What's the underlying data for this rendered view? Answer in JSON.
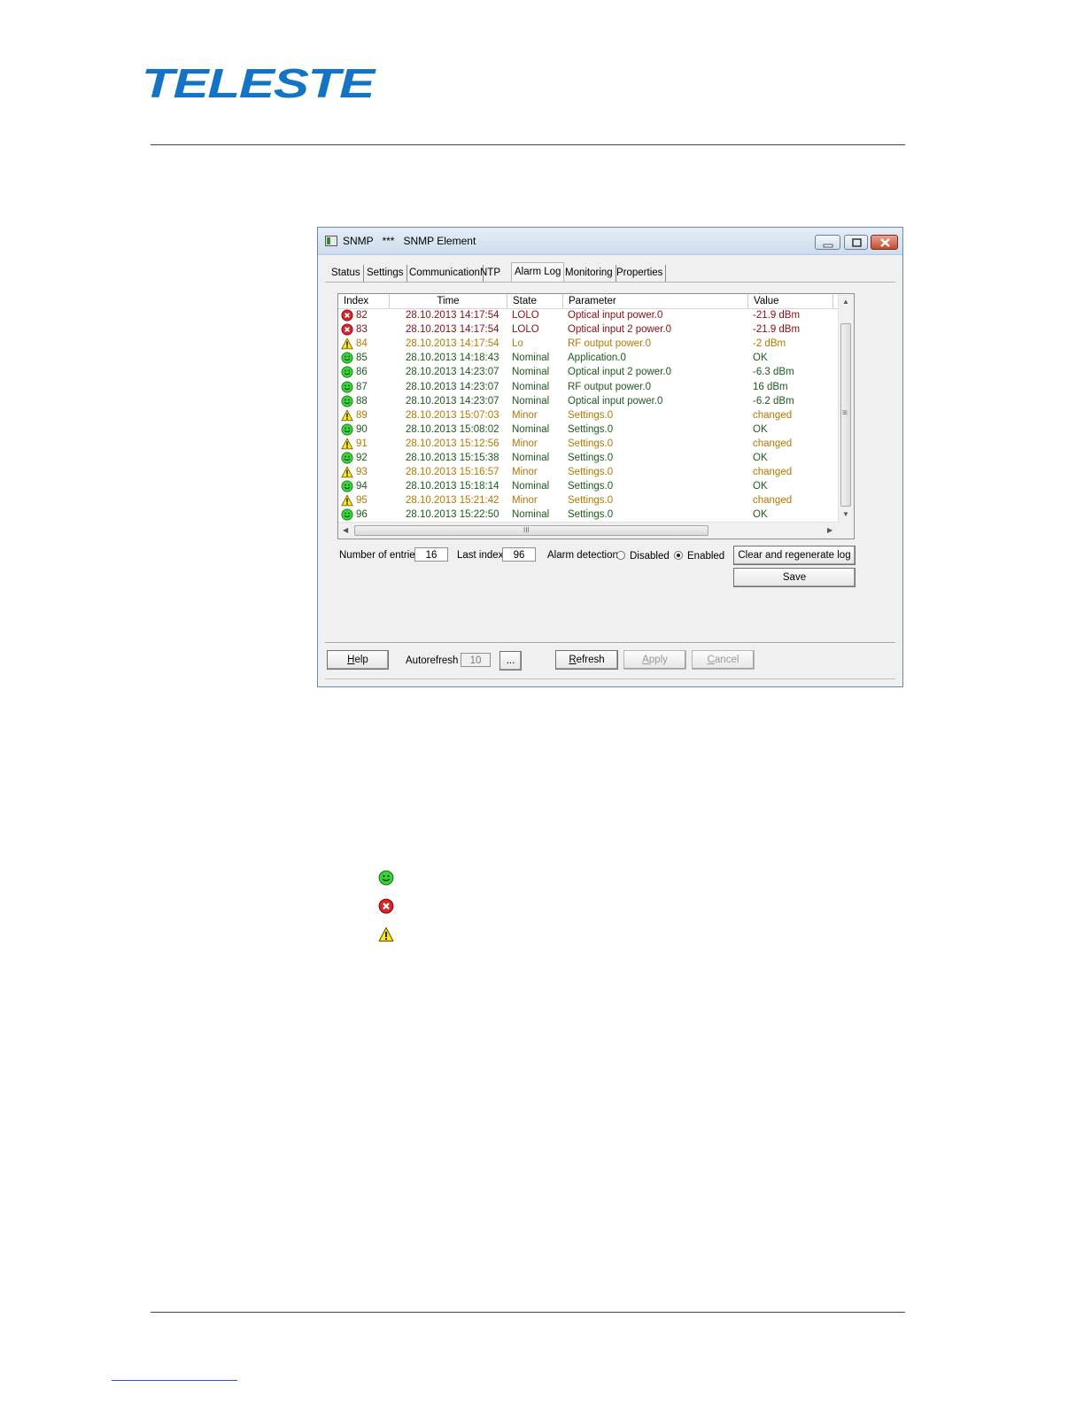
{
  "document": {
    "logo_text": "TELESTE"
  },
  "window": {
    "title": "SNMP   ***   SNMP Element",
    "tabs": [
      {
        "label": "Status"
      },
      {
        "label": "Settings"
      },
      {
        "label": "Communication"
      },
      {
        "label": "NTP"
      },
      {
        "label": "Alarm Log"
      },
      {
        "label": "Monitoring"
      },
      {
        "label": "Properties"
      }
    ],
    "active_tab": "Alarm Log"
  },
  "alarm_log": {
    "columns": {
      "index": "Index",
      "time": "Time",
      "state": "State",
      "parameter": "Parameter",
      "value": "Value"
    },
    "rows": [
      {
        "icon": "error",
        "index": "82",
        "time": "28.10.2013 14:17:54",
        "state": "LOLO",
        "parameter": "Optical input power.0",
        "value": "-21.9 dBm"
      },
      {
        "icon": "error",
        "index": "83",
        "time": "28.10.2013 14:17:54",
        "state": "LOLO",
        "parameter": "Optical input 2 power.0",
        "value": "-21.9 dBm"
      },
      {
        "icon": "warning",
        "index": "84",
        "time": "28.10.2013 14:17:54",
        "state": "Lo",
        "parameter": "RF output power.0",
        "value": "-2 dBm"
      },
      {
        "icon": "ok",
        "index": "85",
        "time": "28.10.2013 14:18:43",
        "state": "Nominal",
        "parameter": "Application.0",
        "value": "OK"
      },
      {
        "icon": "ok",
        "index": "86",
        "time": "28.10.2013 14:23:07",
        "state": "Nominal",
        "parameter": "Optical input 2 power.0",
        "value": "-6.3 dBm"
      },
      {
        "icon": "ok",
        "index": "87",
        "time": "28.10.2013 14:23:07",
        "state": "Nominal",
        "parameter": "RF output power.0",
        "value": "16 dBm"
      },
      {
        "icon": "ok",
        "index": "88",
        "time": "28.10.2013 14:23:07",
        "state": "Nominal",
        "parameter": "Optical input power.0",
        "value": "-6.2 dBm"
      },
      {
        "icon": "warning",
        "index": "89",
        "time": "28.10.2013 15:07:03",
        "state": "Minor",
        "parameter": "Settings.0",
        "value": "changed"
      },
      {
        "icon": "ok",
        "index": "90",
        "time": "28.10.2013 15:08:02",
        "state": "Nominal",
        "parameter": "Settings.0",
        "value": "OK"
      },
      {
        "icon": "warning",
        "index": "91",
        "time": "28.10.2013 15:12:56",
        "state": "Minor",
        "parameter": "Settings.0",
        "value": "changed"
      },
      {
        "icon": "ok",
        "index": "92",
        "time": "28.10.2013 15:15:38",
        "state": "Nominal",
        "parameter": "Settings.0",
        "value": "OK"
      },
      {
        "icon": "warning",
        "index": "93",
        "time": "28.10.2013 15:16:57",
        "state": "Minor",
        "parameter": "Settings.0",
        "value": "changed"
      },
      {
        "icon": "ok",
        "index": "94",
        "time": "28.10.2013 15:18:14",
        "state": "Nominal",
        "parameter": "Settings.0",
        "value": "OK"
      },
      {
        "icon": "warning",
        "index": "95",
        "time": "28.10.2013 15:21:42",
        "state": "Minor",
        "parameter": "Settings.0",
        "value": "changed"
      },
      {
        "icon": "ok",
        "index": "96",
        "time": "28.10.2013 15:22:50",
        "state": "Nominal",
        "parameter": "Settings.0",
        "value": "OK"
      }
    ],
    "hscroll_grip": "III",
    "vscroll_grip": "≡"
  },
  "controls": {
    "number_of_entries_label": "Number of entries",
    "number_of_entries_value": "16",
    "last_index_label": "Last index",
    "last_index_value": "96",
    "alarm_detection_label": "Alarm detection",
    "disabled_label": "Disabled",
    "enabled_label": "Enabled",
    "alarm_detection_selected": "Enabled",
    "clear_button": "Clear and regenerate log",
    "save_button": "Save"
  },
  "footer_bar": {
    "help_button_prefix": "H",
    "help_button_rest": "elp",
    "autorefresh_label": "Autorefresh",
    "autorefresh_value": "10",
    "ellipsis_button": "...",
    "refresh_button_prefix": "R",
    "refresh_button_rest": "efresh",
    "apply_button_prefix": "A",
    "apply_button_rest": "pply",
    "cancel_button_prefix": "C",
    "cancel_button_rest": "ancel"
  },
  "colors": {
    "error_text": "#8a0f14",
    "warning_text": "#b47a00",
    "ok_text": "#1e5a1e",
    "logo_blue": "#1473c4"
  },
  "legend": [
    {
      "icon": "ok"
    },
    {
      "icon": "error"
    },
    {
      "icon": "warning"
    }
  ]
}
